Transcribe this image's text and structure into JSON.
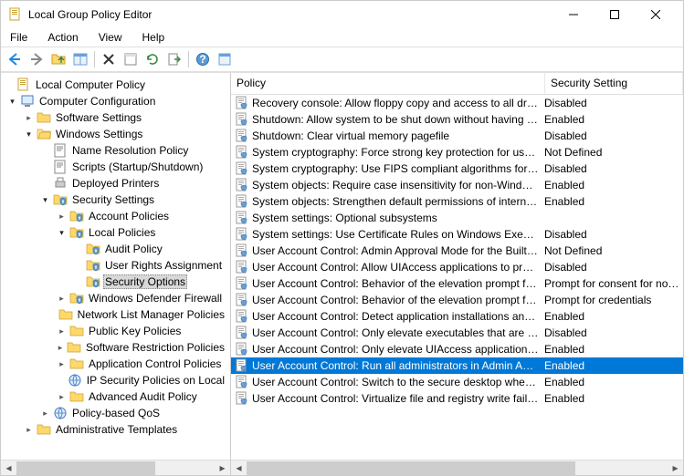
{
  "window": {
    "title": "Local Group Policy Editor"
  },
  "menu": {
    "file": "File",
    "action": "Action",
    "view": "View",
    "help": "Help"
  },
  "tree": {
    "root": "Local Computer Policy",
    "cfg": "Computer Configuration",
    "sw": "Software Settings",
    "win": "Windows Settings",
    "nrp": "Name Resolution Policy",
    "scripts": "Scripts (Startup/Shutdown)",
    "printers": "Deployed Printers",
    "sec": "Security Settings",
    "acct": "Account Policies",
    "local": "Local Policies",
    "audit": "Audit Policy",
    "ura": "User Rights Assignment",
    "secopt": "Security Options",
    "wdf": "Windows Defender Firewall",
    "nlm": "Network List Manager Policies",
    "pkp": "Public Key Policies",
    "srp": "Software Restriction Policies",
    "acp": "Application Control Policies",
    "ipsec": "IP Security Policies on Local",
    "aap": "Advanced Audit Policy",
    "qos": "Policy-based QoS",
    "admt": "Administrative Templates"
  },
  "columns": {
    "policy": "Policy",
    "setting": "Security Setting"
  },
  "policies": [
    {
      "name": "Recovery console: Allow floppy copy and access to all drives…",
      "setting": "Disabled"
    },
    {
      "name": "Shutdown: Allow system to be shut down without having to…",
      "setting": "Enabled"
    },
    {
      "name": "Shutdown: Clear virtual memory pagefile",
      "setting": "Disabled"
    },
    {
      "name": "System cryptography: Force strong key protection for user k…",
      "setting": "Not Defined"
    },
    {
      "name": "System cryptography: Use FIPS compliant algorithms for en…",
      "setting": "Disabled"
    },
    {
      "name": "System objects: Require case insensitivity for non-Windows …",
      "setting": "Enabled"
    },
    {
      "name": "System objects: Strengthen default permissions of internal s…",
      "setting": "Enabled"
    },
    {
      "name": "System settings: Optional subsystems",
      "setting": ""
    },
    {
      "name": "System settings: Use Certificate Rules on Windows Executab…",
      "setting": "Disabled"
    },
    {
      "name": "User Account Control: Admin Approval Mode for the Built-i…",
      "setting": "Not Defined"
    },
    {
      "name": "User Account Control: Allow UIAccess applications to prom…",
      "setting": "Disabled"
    },
    {
      "name": "User Account Control: Behavior of the elevation prompt for …",
      "setting": "Prompt for consent for non-Windows…"
    },
    {
      "name": "User Account Control: Behavior of the elevation prompt for …",
      "setting": "Prompt for credentials"
    },
    {
      "name": "User Account Control: Detect application installations and p…",
      "setting": "Enabled"
    },
    {
      "name": "User Account Control: Only elevate executables that are sig…",
      "setting": "Disabled"
    },
    {
      "name": "User Account Control: Only elevate UIAccess applications th…",
      "setting": "Enabled"
    },
    {
      "name": "User Account Control: Run all administrators in Admin Appr…",
      "setting": "Enabled",
      "selected": true
    },
    {
      "name": "User Account Control: Switch to the secure desktop when pr…",
      "setting": "Enabled"
    },
    {
      "name": "User Account Control: Virtualize file and registry write failure…",
      "setting": "Enabled"
    }
  ]
}
